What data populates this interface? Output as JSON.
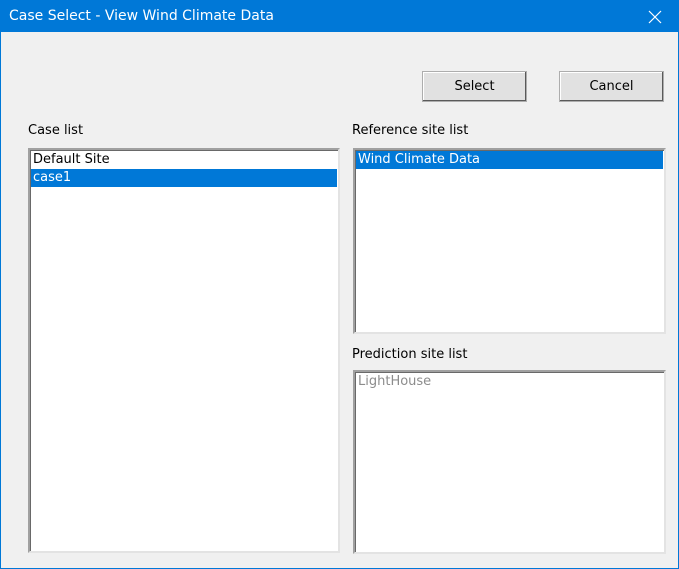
{
  "window": {
    "title": "Case Select - View Wind Climate Data",
    "close_icon": "close-icon",
    "accent_color": "#0078d7"
  },
  "buttons": {
    "select_label": "Select",
    "cancel_label": "Cancel"
  },
  "case_list": {
    "label": "Case list",
    "items": [
      {
        "label": "Default Site",
        "selected": false
      },
      {
        "label": "case1",
        "selected": true
      }
    ]
  },
  "reference_site_list": {
    "label": "Reference site list",
    "items": [
      {
        "label": "Wind Climate Data",
        "selected": true
      }
    ]
  },
  "prediction_site_list": {
    "label": "Prediction site list",
    "enabled": false,
    "items": [
      {
        "label": "LightHouse",
        "selected": false
      }
    ]
  }
}
